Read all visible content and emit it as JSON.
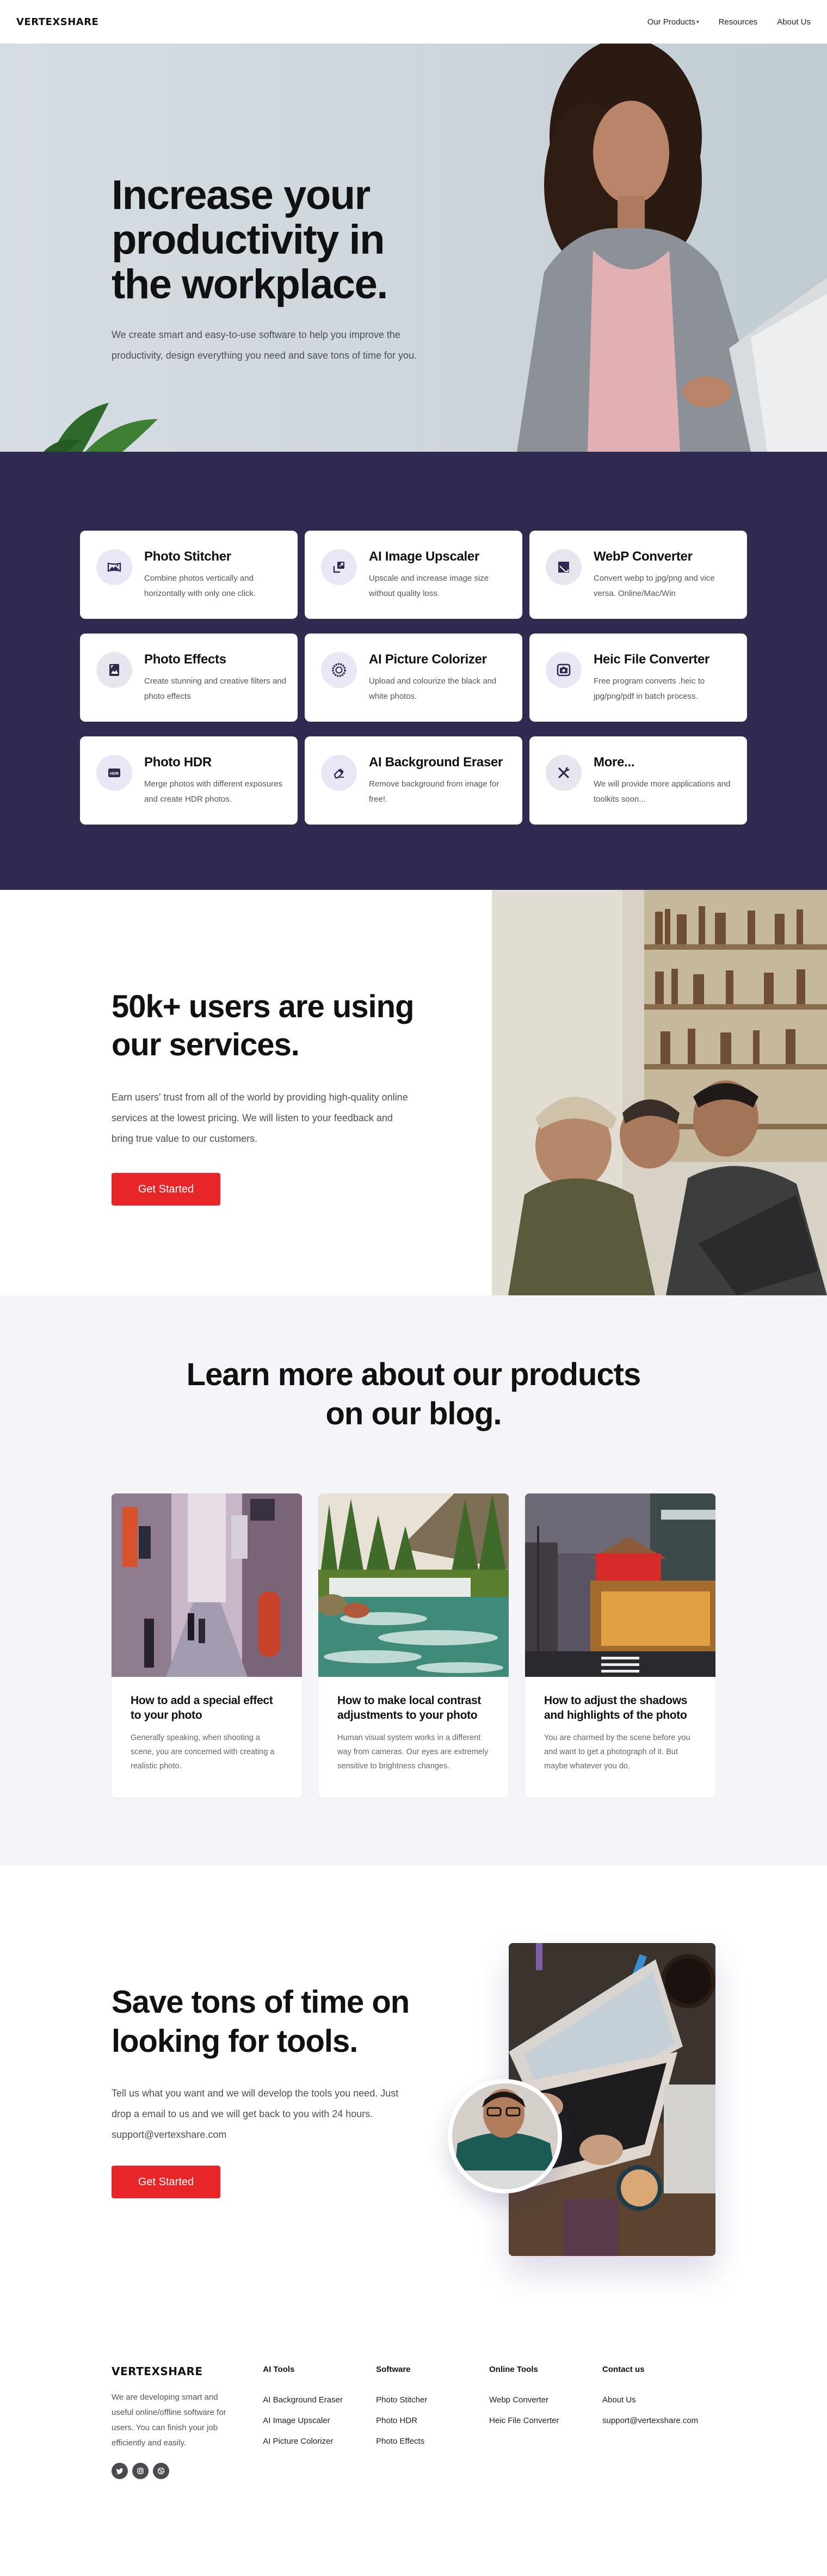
{
  "header": {
    "logo": "VERTEXSHARE",
    "nav": [
      {
        "label": "Our Products",
        "has_dropdown": true
      },
      {
        "label": "Resources"
      },
      {
        "label": "About Us"
      }
    ]
  },
  "hero": {
    "title": "Increase your productivity in the workplace.",
    "description": "We create smart and easy-to-use software to help you improve the productivity, design everything you need and save tons of time for you."
  },
  "tools": {
    "items": [
      {
        "icon": "panorama-icon",
        "title": "Photo Stitcher",
        "description": "Combine photos vertically and horizontally with only one click."
      },
      {
        "icon": "upscale-arrow-icon",
        "title": "AI Image Upscaler",
        "description": "Upscale and increase image size without quality loss."
      },
      {
        "icon": "image-convert-icon",
        "title": "WebP Converter",
        "description": "Convert webp to jpg/png and vice versa. Online/Mac/Win"
      },
      {
        "icon": "photo-effects-icon",
        "title": "Photo Effects",
        "description": "Create stunning and creative filters and photo effects"
      },
      {
        "icon": "aperture-icon",
        "title": "AI Picture Colorizer",
        "description": "Upload and colourize the black and white photos."
      },
      {
        "icon": "camera-icon",
        "title": "Heic File Converter",
        "description": "Free program converts .heic to jpg/png/pdf in batch process."
      },
      {
        "icon": "hdr-icon",
        "title": "Photo HDR",
        "description": "Merge photos with different exposures and create HDR photos."
      },
      {
        "icon": "eraser-icon",
        "title": "AI Background Eraser",
        "description": "Remove background from image for free!."
      },
      {
        "icon": "tools-icon",
        "title": "More...",
        "description": "We will provide more applications and toolkits soon..."
      }
    ],
    "hdr_badge": "HDR"
  },
  "users": {
    "title": "50k+ users are using our services.",
    "description": "Earn users' trust from all of the world by providing high-quality online services at the lowest pricing. We will listen to your feedback and bring true value to our customers.",
    "cta": "Get Started"
  },
  "blog": {
    "title": "Learn more about our products on our blog.",
    "posts": [
      {
        "title": "How to add a special effect to your photo",
        "excerpt": "Generally speaking, when shooting a scene, you are concerned with creating a realistic photo."
      },
      {
        "title": "How to make local contrast adjustments to your photo",
        "excerpt": "Human visual system works in a different way from cameras. Our eyes are extremely sensitive to brightness changes."
      },
      {
        "title": "How to adjust the shadows and highlights of the photo",
        "excerpt": "You are charmed by the scene before you and want to get a photograph of it. But maybe whatever you do,"
      }
    ]
  },
  "save": {
    "title": "Save tons of time on looking for tools.",
    "description": "Tell us what you want and we will develop the tools you need. Just drop a email to us and we will get back to you with 24 hours. support@vertexshare.com",
    "cta": "Get Started"
  },
  "footer": {
    "logo": "VERTEXSHARE",
    "about": "We are developing smart and useful online/offline software for users. You can finish your job efficiently and easily.",
    "socials": [
      "twitter-icon",
      "instagram-icon",
      "dribbble-icon"
    ],
    "columns": [
      {
        "title": "AI Tools",
        "links": [
          "AI Background Eraser",
          "AI Image Upscaler",
          "AI Picture Colorizer"
        ]
      },
      {
        "title": "Software",
        "links": [
          "Photo Stitcher",
          "Photo HDR",
          "Photo Effects"
        ]
      },
      {
        "title": "Online Tools",
        "links": [
          "Webp Converter",
          "Heic File Converter"
        ]
      },
      {
        "title": "Contact us",
        "links": [
          "About Us",
          "support@vertexshare.com"
        ]
      }
    ]
  },
  "colors": {
    "brand_dark": "#2f2b50",
    "accent_red": "#e8262a",
    "icon_bg": "#e9e7f5",
    "blog_bg": "#f5f5f9"
  }
}
